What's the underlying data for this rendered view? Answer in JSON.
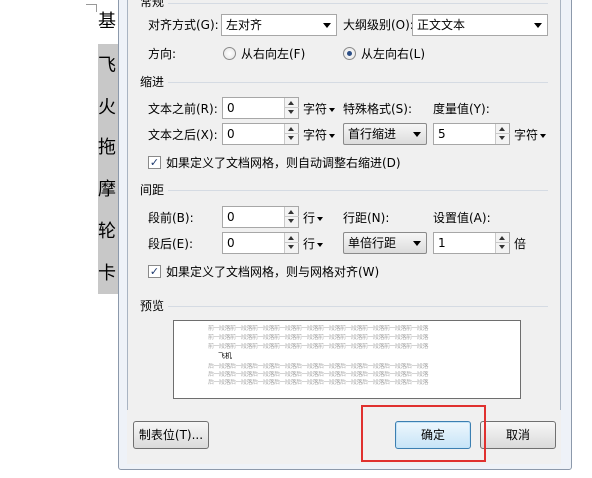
{
  "document": {
    "chars": [
      "基",
      "飞",
      "火",
      "拖",
      "摩",
      "轮",
      "卡"
    ]
  },
  "dialog": {
    "sections": {
      "general": "常规",
      "indent": "缩进",
      "spacing": "间距",
      "preview": "预览"
    },
    "general": {
      "alignment_label": "对齐方式(G):",
      "alignment_value": "左对齐",
      "outline_label": "大纲级别(O):",
      "outline_value": "正文文本",
      "direction_label": "方向:",
      "rtl_label": "从右向左(F)",
      "ltr_label": "从左向右(L)",
      "direction_selected": "ltr"
    },
    "indent": {
      "before_label": "文本之前(R):",
      "before_value": "0",
      "before_unit": "字符",
      "after_label": "文本之后(X):",
      "after_value": "0",
      "after_unit": "字符",
      "special_label": "特殊格式(S):",
      "special_value": "首行缩进",
      "measure_label": "度量值(Y):",
      "measure_value": "5",
      "measure_unit": "字符",
      "auto_adjust_label": "如果定义了文档网格，则自动调整右缩进(D)",
      "auto_adjust_checked": true
    },
    "spacing": {
      "before_label": "段前(B):",
      "before_value": "0",
      "before_unit": "行",
      "after_label": "段后(E):",
      "after_value": "0",
      "after_unit": "行",
      "line_label": "行距(N):",
      "line_value": "单倍行距",
      "setting_label": "设置值(A):",
      "setting_value": "1",
      "setting_unit": "倍",
      "grid_align_label": "如果定义了文档网格，则与网格对齐(W)",
      "grid_align_checked": true
    },
    "preview": {
      "filler_line": "前一段落前一段落前一段落前一段落前一段落前一段落前一段落前一段落前一段落前一段落",
      "main_text": "飞机",
      "after_line": "后一段落后一段落后一段落后一段落后一段落后一段落后一段落后一段落后一段落后一段落"
    },
    "buttons": {
      "tabs": "制表位(T)...",
      "ok": "确定",
      "cancel": "取消"
    }
  },
  "colors": {
    "highlight": "#e0312f",
    "selection": "#c8c8c8"
  }
}
